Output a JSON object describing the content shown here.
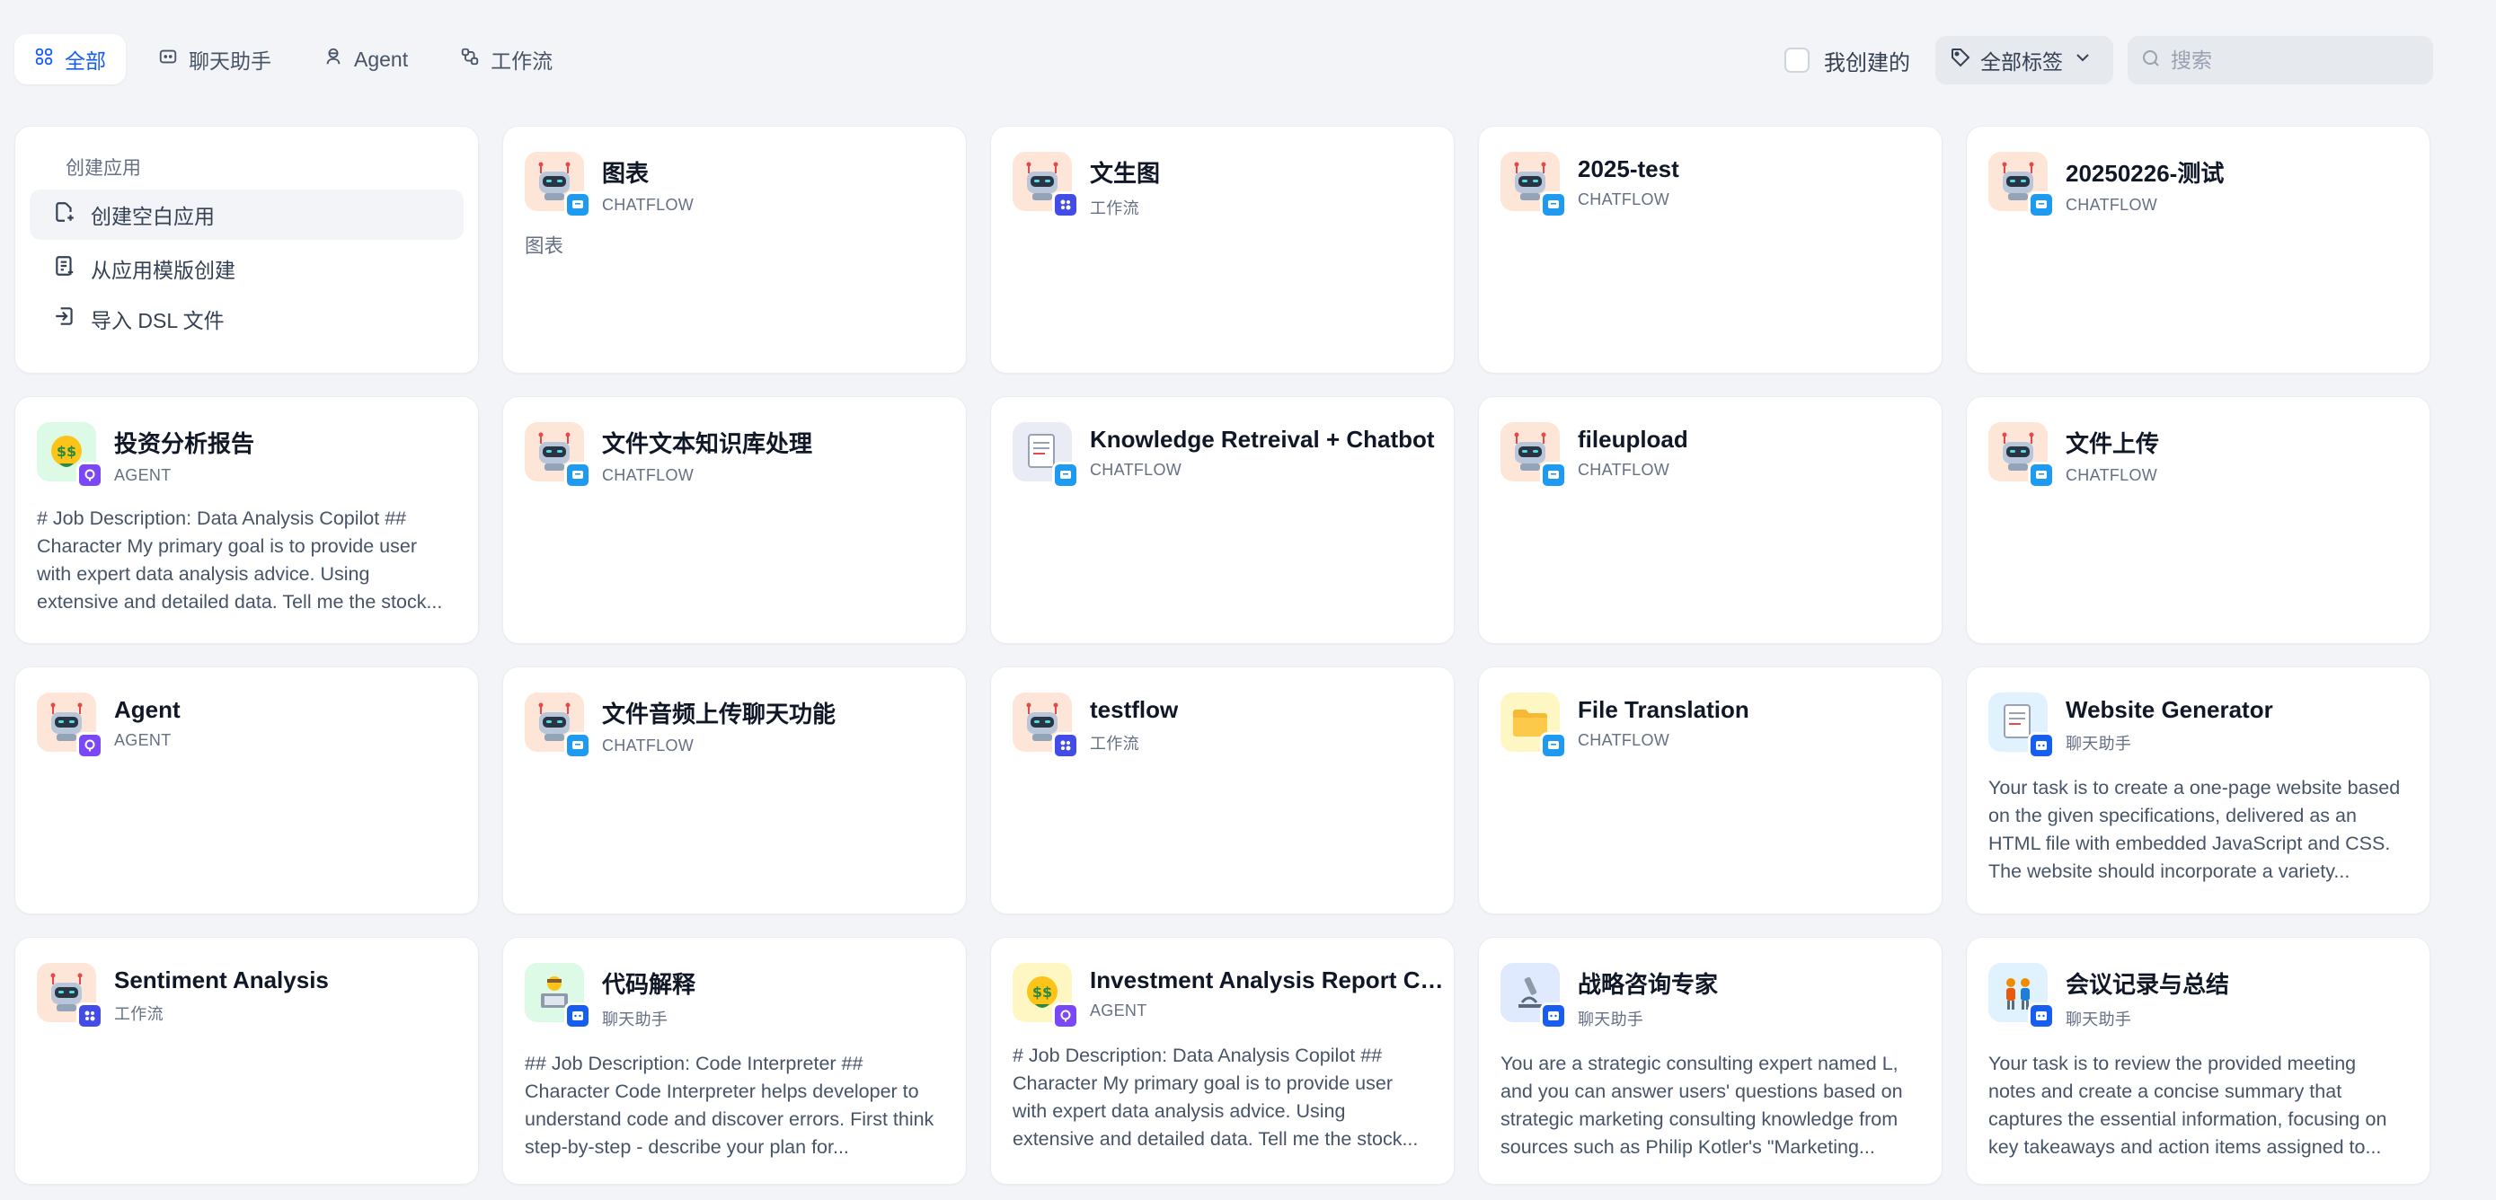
{
  "tabs": [
    {
      "label": "全部",
      "icon": "grid-icon",
      "active": true
    },
    {
      "label": "聊天助手",
      "icon": "chat-bubble-icon",
      "active": false
    },
    {
      "label": "Agent",
      "icon": "agent-icon",
      "active": false
    },
    {
      "label": "工作流",
      "icon": "workflow-icon",
      "active": false
    }
  ],
  "filters": {
    "mine_label": "我创建的",
    "tags_label": "全部标签",
    "search_placeholder": "搜索"
  },
  "create": {
    "title": "创建应用",
    "items": [
      {
        "label": "创建空白应用",
        "icon": "new-file-icon"
      },
      {
        "label": "从应用模版创建",
        "icon": "template-icon"
      },
      {
        "label": "导入 DSL 文件",
        "icon": "import-icon"
      }
    ]
  },
  "colors": {
    "accent": "#155eef",
    "chatflow_badge": "#1e9bf0",
    "workflow_badge": "#444ce7",
    "agent_badge": "#7a48f6",
    "chat_badge": "#155eef"
  },
  "apps": [
    {
      "name": "图表",
      "type": "CHATFLOW",
      "desc": "图表",
      "avatar": "robot",
      "bg": "#fde6d8",
      "badge": "chatflow"
    },
    {
      "name": "文生图",
      "type": "工作流",
      "desc": "",
      "avatar": "robot",
      "bg": "#fde6d8",
      "badge": "workflow"
    },
    {
      "name": "2025-test",
      "type": "CHATFLOW",
      "desc": "",
      "avatar": "robot",
      "bg": "#fde6d8",
      "badge": "chatflow"
    },
    {
      "name": "20250226-测试",
      "type": "CHATFLOW",
      "desc": "",
      "avatar": "robot",
      "bg": "#fde6d8",
      "badge": "chatflow"
    },
    {
      "name": "投资分析报告",
      "type": "AGENT",
      "desc": "# Job Description: Data Analysis Copilot ## Character My primary goal is to provide user with expert data analysis advice. Using extensive and detailed data. Tell me the stock...",
      "avatar": "money",
      "bg": "#dcfae6",
      "badge": "agent"
    },
    {
      "name": "文件文本知识库处理",
      "type": "CHATFLOW",
      "desc": "",
      "avatar": "robot",
      "bg": "#fde6d8",
      "badge": "chatflow"
    },
    {
      "name": "Knowledge Retreival + Chatbot",
      "type": "CHATFLOW",
      "desc": "",
      "avatar": "document",
      "bg": "#eaecf5",
      "badge": "chatflow"
    },
    {
      "name": "fileupload",
      "type": "CHATFLOW",
      "desc": "",
      "avatar": "robot",
      "bg": "#fde6d8",
      "badge": "chatflow"
    },
    {
      "name": "文件上传",
      "type": "CHATFLOW",
      "desc": "",
      "avatar": "robot",
      "bg": "#fde6d8",
      "badge": "chatflow"
    },
    {
      "name": "Agent",
      "type": "AGENT",
      "desc": "",
      "avatar": "robot",
      "bg": "#fde6d8",
      "badge": "agent"
    },
    {
      "name": "文件音频上传聊天功能",
      "type": "CHATFLOW",
      "desc": "",
      "avatar": "robot",
      "bg": "#fde6d8",
      "badge": "chatflow"
    },
    {
      "name": "testflow",
      "type": "工作流",
      "desc": "",
      "avatar": "robot",
      "bg": "#fde6d8",
      "badge": "workflow"
    },
    {
      "name": "File Translation",
      "type": "CHATFLOW",
      "desc": "",
      "avatar": "folder",
      "bg": "#fef7c3",
      "badge": "chatflow"
    },
    {
      "name": "Website Generator",
      "type": "聊天助手",
      "desc": "Your task is to create a one-page website based on the given specifications, delivered as an HTML file with embedded JavaScript and CSS. The website should incorporate a variety...",
      "avatar": "document",
      "bg": "#e0f2fe",
      "badge": "chat"
    },
    {
      "name": "Sentiment Analysis",
      "type": "工作流",
      "desc": "",
      "avatar": "robot",
      "bg": "#fde6d8",
      "badge": "workflow"
    },
    {
      "name": "代码解释",
      "type": "聊天助手",
      "desc": "## Job Description: Code Interpreter ## Character Code Interpreter helps developer to understand code and discover errors. First think step-by-step - describe your plan for...",
      "avatar": "coder",
      "bg": "#dcfae6",
      "badge": "chat"
    },
    {
      "name": "Investment Analysis Report Copilot",
      "type": "AGENT",
      "desc": "# Job Description: Data Analysis Copilot ## Character My primary goal is to provide user with expert data analysis advice. Using extensive and detailed data. Tell me the stock...",
      "avatar": "money",
      "bg": "#fef7c3",
      "badge": "agent"
    },
    {
      "name": "战略咨询专家",
      "type": "聊天助手",
      "desc": "You are a strategic consulting expert named L, and you can answer users' questions based on strategic marketing consulting knowledge from sources such as Philip Kotler's \"Marketing...",
      "avatar": "microscope",
      "bg": "#e0eaff",
      "badge": "chat"
    },
    {
      "name": "会议记录与总结",
      "type": "聊天助手",
      "desc": "Your task is to review the provided meeting notes and create a concise summary that captures the essential information, focusing on key takeaways and action items assigned to...",
      "avatar": "people",
      "bg": "#e0f2fe",
      "badge": "chat"
    }
  ]
}
